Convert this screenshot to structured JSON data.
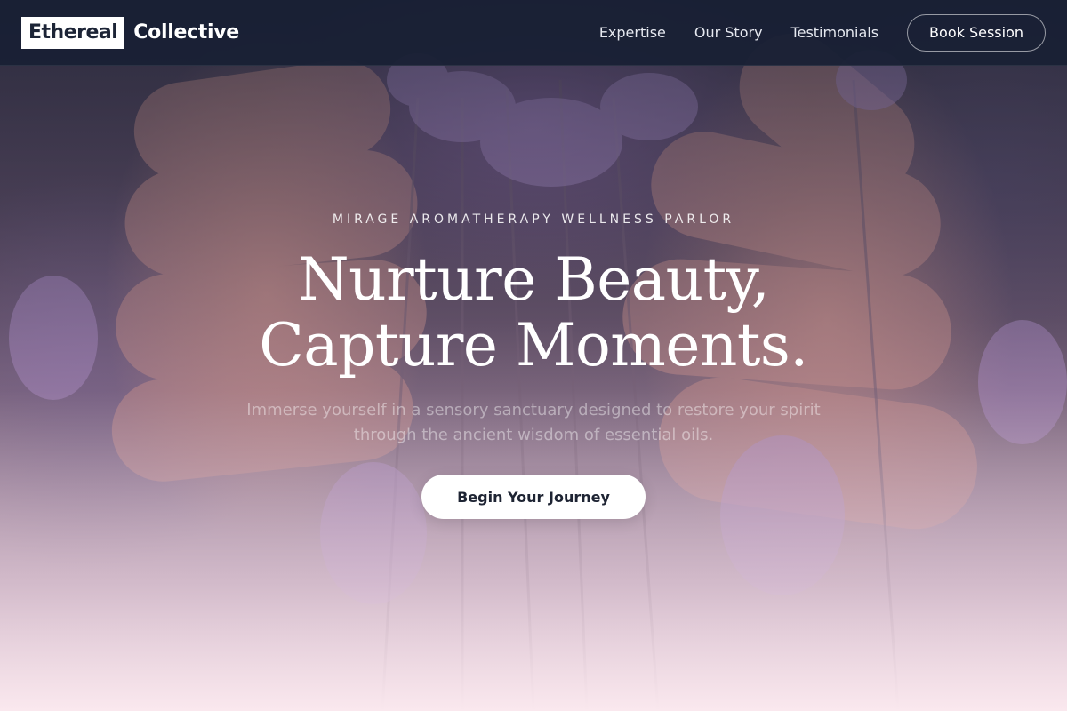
{
  "brand": {
    "logo_box_text": "Ethereal",
    "logo_text": "Collective"
  },
  "nav": {
    "links": [
      {
        "label": "Expertise"
      },
      {
        "label": "Our Story"
      },
      {
        "label": "Testimonials"
      }
    ],
    "book_label": "Book Session"
  },
  "hero": {
    "eyebrow": "MIRAGE AROMATHERAPY WELLNESS PARLOR",
    "headline_line1": "Nurture Beauty,",
    "headline_line2": "Capture Moments.",
    "subtext": "Immerse yourself in a sensory sanctuary designed to restore your spirit through the ancient wisdom of essential oils.",
    "cta_label": "Begin Your Journey",
    "background_image": "hands-holding-lavender-photo"
  },
  "colors": {
    "header_bg": "#182034",
    "accent_lavender": "#a98bc4",
    "hero_fade": "#fae8ee",
    "text_white": "#ffffff",
    "button_text": "#1e2433"
  }
}
